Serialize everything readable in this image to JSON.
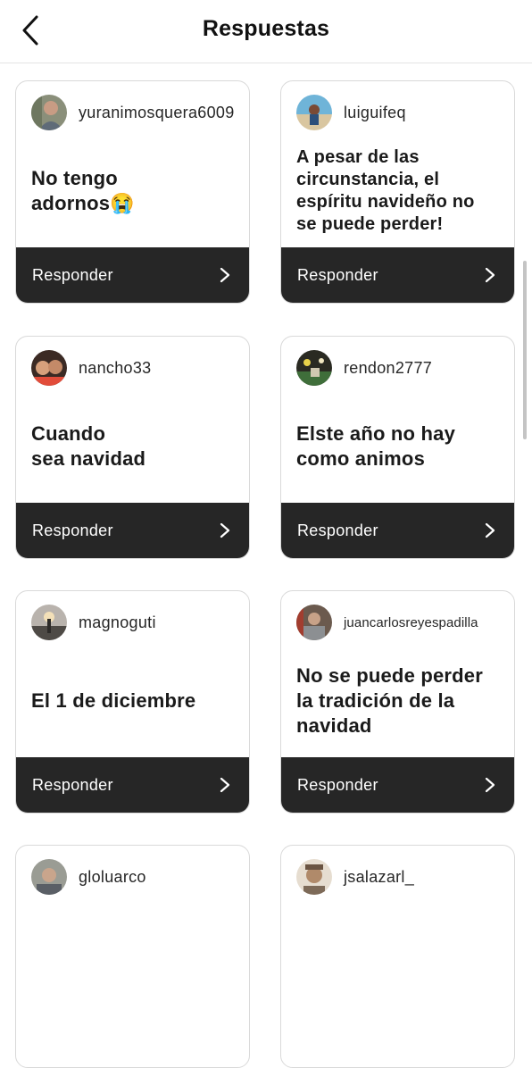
{
  "header": {
    "title": "Respuestas"
  },
  "cards": [
    {
      "username": "yuranimosquera6009",
      "text": "No tengo\nadornos😭",
      "reply_label": "Responder"
    },
    {
      "username": "luiguifeq",
      "text": "A pesar de las\ncircunstancia, el\nespíritu navideño no\nse puede perder!",
      "reply_label": "Responder"
    },
    {
      "username": "nancho33",
      "text": "Cuando\nsea navidad",
      "reply_label": "Responder"
    },
    {
      "username": "rendon2777",
      "text": "Elste  año  no  hay\ncomo  animos",
      "reply_label": "Responder"
    },
    {
      "username": "magnoguti",
      "text": "El 1 de diciembre",
      "reply_label": "Responder"
    },
    {
      "username": "juancarlosreyespadilla",
      "text": "No se puede perder\nla tradición de la\nnavidad",
      "reply_label": "Responder"
    },
    {
      "username": "gloluarco"
    },
    {
      "username": "jsalazarl_"
    }
  ]
}
